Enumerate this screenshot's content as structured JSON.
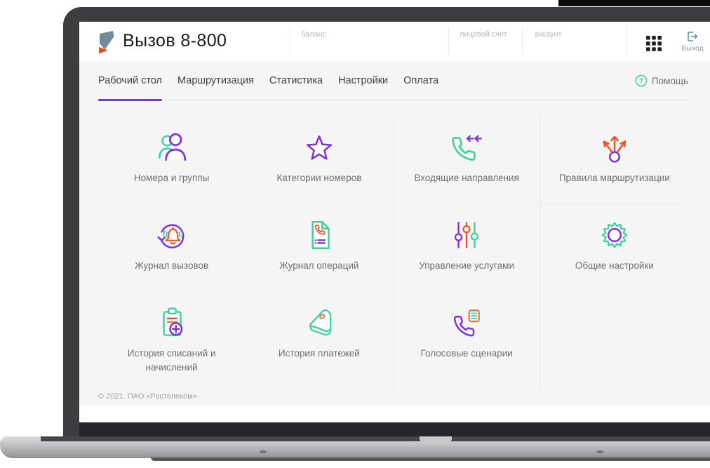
{
  "header": {
    "app_title": "Вызов 8-800",
    "info_fields": [
      {
        "label": "баланс"
      },
      {
        "label": "лицевой счет"
      },
      {
        "label": "аккаунт"
      }
    ],
    "apps_icon": "grid-apps-icon",
    "logout": {
      "label": "Выход",
      "icon": "logout-icon"
    }
  },
  "nav": {
    "tabs": [
      {
        "label": "Рабочий стол",
        "active": true
      },
      {
        "label": "Маршрутизация",
        "active": false
      },
      {
        "label": "Статистика",
        "active": false
      },
      {
        "label": "Настройки",
        "active": false
      },
      {
        "label": "Оплата",
        "active": false
      }
    ],
    "help_label": "Помощь",
    "help_icon": "question-circle-icon"
  },
  "tiles": [
    {
      "label": "Номера и группы",
      "icon": "users-icon"
    },
    {
      "label": "Категории номеров",
      "icon": "star-icon"
    },
    {
      "label": "Входящие направления",
      "icon": "phone-incoming-icon"
    },
    {
      "label": "Правила маршрутизации",
      "icon": "route-branch-icon"
    },
    {
      "label": "Журнал вызовов",
      "icon": "call-journal-icon"
    },
    {
      "label": "Журнал операций",
      "icon": "operations-journal-icon"
    },
    {
      "label": "Управление услугами",
      "icon": "sliders-icon"
    },
    {
      "label": "Общие настройки",
      "icon": "gear-icon"
    },
    {
      "label": "История списаний и начислений",
      "icon": "clipboard-plus-icon"
    },
    {
      "label": "История платежей",
      "icon": "wallet-icon"
    },
    {
      "label": "Голосовые сценарии",
      "icon": "voice-script-icon"
    }
  ],
  "footer": {
    "copyright": "© 2021. ПАО «Ростелеком»"
  },
  "colors": {
    "accent_purple": "#7c2fe3",
    "accent_green": "#3ecfa0",
    "accent_orange": "#ee5226",
    "logo_slate": "#6e8c99",
    "logo_orange": "#f0481c",
    "logout_teal": "#4b9a8e",
    "page_background": "#f5f5f6"
  }
}
